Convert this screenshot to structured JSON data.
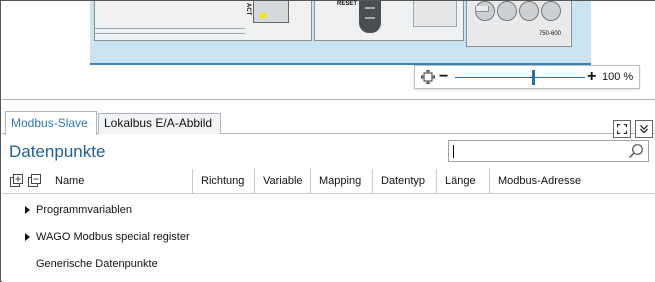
{
  "device": {
    "act_label": "ACT",
    "reset_label": "RESET",
    "module_label": "750-600"
  },
  "zoom": {
    "minus": "−",
    "plus": "+",
    "level_text": "100 %",
    "level_fraction": 0.6
  },
  "tabs": [
    {
      "label": "Modbus-Slave",
      "active": true
    },
    {
      "label": "Lokalbus E/A-Abbild",
      "active": false
    }
  ],
  "panel": {
    "title": "Datenpunkte",
    "search_value": ""
  },
  "table": {
    "columns": [
      "Name",
      "Richtung",
      "Variable",
      "Mapping",
      "Datentyp",
      "Länge",
      "Modbus-Adresse"
    ],
    "rows": [
      {
        "label": "Programmvariablen",
        "expandable": true
      },
      {
        "label": "WAGO Modbus special register",
        "expandable": true
      },
      {
        "label": "Generische Datenpunkte",
        "expandable": false
      }
    ]
  },
  "colors": {
    "accent": "#2a78b5",
    "title": "#1f5f93",
    "device_background": "#c9e3f3"
  }
}
